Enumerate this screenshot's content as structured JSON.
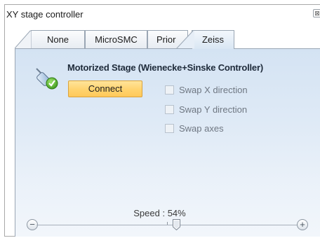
{
  "window": {
    "title": "XY stage controller",
    "close_glyph": "⊠"
  },
  "tabs": [
    {
      "label": "None"
    },
    {
      "label": "MicroSMC"
    },
    {
      "label": "Prior"
    },
    {
      "label": "Zeiss",
      "active": true
    }
  ],
  "stage": {
    "icon": "stage-connected-icon",
    "title": "Motorized Stage (Wienecke+Sinske Controller)",
    "connect_label": "Connect"
  },
  "options": [
    {
      "label": "Swap X direction",
      "checked": false,
      "enabled": false
    },
    {
      "label": "Swap Y direction",
      "checked": false,
      "enabled": false
    },
    {
      "label": "Swap axes",
      "checked": false,
      "enabled": false
    }
  ],
  "speed": {
    "label": "Speed : 54%",
    "value_percent": 54,
    "minus_glyph": "−",
    "plus_glyph": "+"
  },
  "colors": {
    "connect_button": "#ffd36e",
    "panel_bg": "#dfeaf6"
  }
}
